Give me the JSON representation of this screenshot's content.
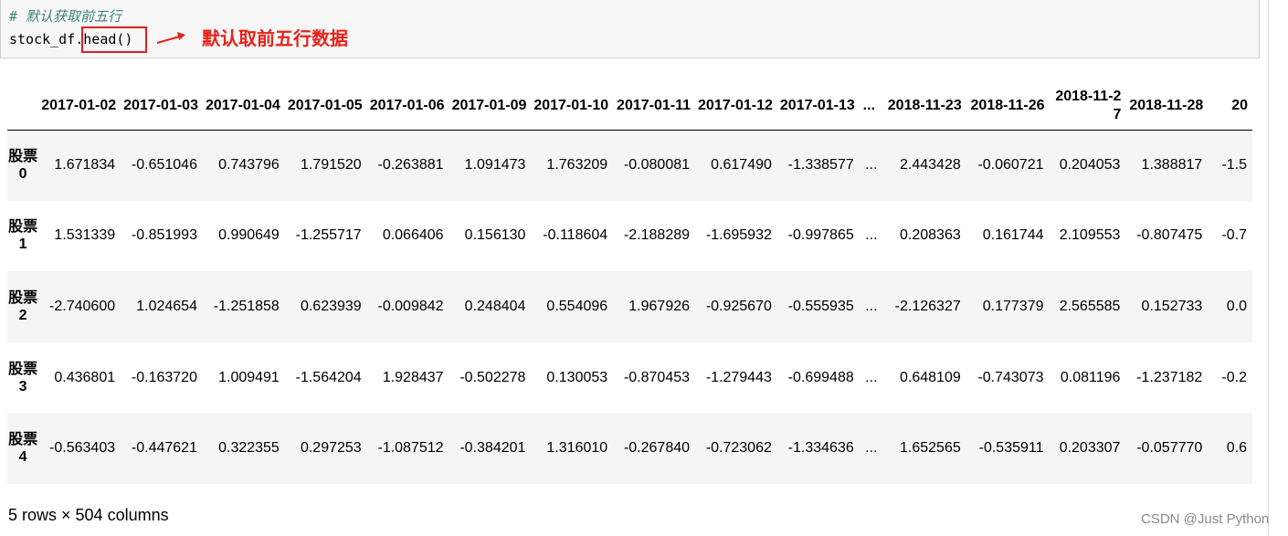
{
  "code_cell": {
    "comment": "# 默认获取前五行",
    "code_prefix": "stock_df.",
    "code_highlight": "head()",
    "annotation": "默认取前五行数据"
  },
  "table": {
    "columns": [
      "2017-01-02",
      "2017-01-03",
      "2017-01-04",
      "2017-01-05",
      "2017-01-06",
      "2017-01-09",
      "2017-01-10",
      "2017-01-11",
      "2017-01-12",
      "2017-01-13",
      "...",
      "2018-11-23",
      "2018-11-26",
      "2018-11-27",
      "2018-11-28",
      "20"
    ],
    "rows": [
      {
        "index": "股票0",
        "values": [
          "1.671834",
          "-0.651046",
          "0.743796",
          "1.791520",
          "-0.263881",
          "1.091473",
          "1.763209",
          "-0.080081",
          "0.617490",
          "-1.338577",
          "...",
          "2.443428",
          "-0.060721",
          "0.204053",
          "1.388817",
          "-1.5"
        ]
      },
      {
        "index": "股票1",
        "values": [
          "1.531339",
          "-0.851993",
          "0.990649",
          "-1.255717",
          "0.066406",
          "0.156130",
          "-0.118604",
          "-2.188289",
          "-1.695932",
          "-0.997865",
          "...",
          "0.208363",
          "0.161744",
          "2.109553",
          "-0.807475",
          "-0.7"
        ]
      },
      {
        "index": "股票2",
        "values": [
          "-2.740600",
          "1.024654",
          "-1.251858",
          "0.623939",
          "-0.009842",
          "0.248404",
          "0.554096",
          "1.967926",
          "-0.925670",
          "-0.555935",
          "...",
          "-2.126327",
          "0.177379",
          "2.565585",
          "0.152733",
          "0.0"
        ]
      },
      {
        "index": "股票3",
        "values": [
          "0.436801",
          "-0.163720",
          "1.009491",
          "-1.564204",
          "1.928437",
          "-0.502278",
          "0.130053",
          "-0.870453",
          "-1.279443",
          "-0.699488",
          "...",
          "0.648109",
          "-0.743073",
          "0.081196",
          "-1.237182",
          "-0.2"
        ]
      },
      {
        "index": "股票4",
        "values": [
          "-0.563403",
          "-0.447621",
          "0.322355",
          "0.297253",
          "-1.087512",
          "-0.384201",
          "1.316010",
          "-0.267840",
          "-0.723062",
          "-1.334636",
          "...",
          "1.652565",
          "-0.535911",
          "0.203307",
          "-0.057770",
          "0.6"
        ]
      }
    ]
  },
  "footer": "5 rows × 504 columns",
  "watermark": "CSDN @Just Python",
  "colors": {
    "annotation_red": "#e8221a",
    "comment_teal": "#408080",
    "row_stripe": "#f5f5f5"
  }
}
